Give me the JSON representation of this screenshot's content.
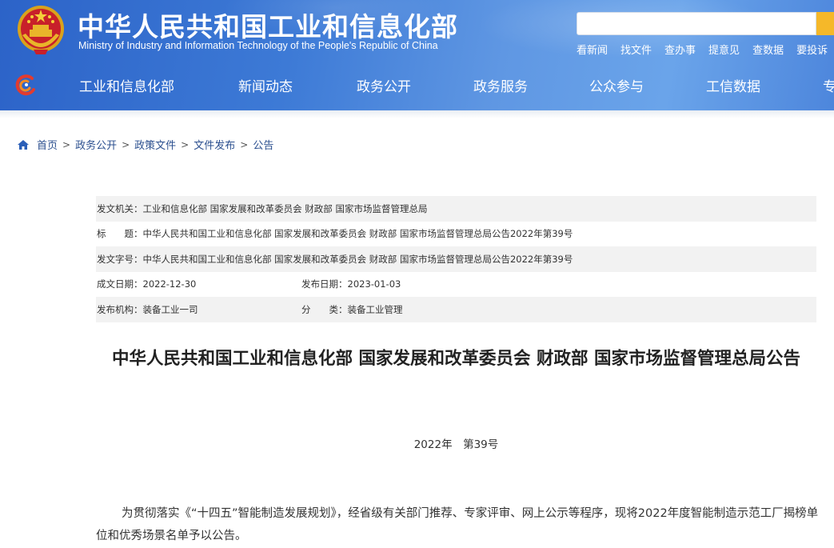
{
  "header": {
    "site_title": "中华人民共和国工业和信息化部",
    "site_subtitle": "Ministry of Industry and Information Technology of the People's Republic of China",
    "search": {
      "placeholder": ""
    },
    "quick_links": [
      "看新闻",
      "找文件",
      "查办事",
      "提意见",
      "查数据",
      "要投诉"
    ],
    "nav": [
      "工业和信息化部",
      "新闻动态",
      "政务公开",
      "政务服务",
      "公众参与",
      "工信数据",
      "专"
    ]
  },
  "breadcrumb": [
    "首页",
    "政务公开",
    "政策文件",
    "文件发布",
    "公告"
  ],
  "meta": {
    "issuing_org_label": "发文机关：",
    "issuing_org": "工业和信息化部 国家发展和改革委员会 财政部 国家市场监督管理总局",
    "title_label": "标　　题：",
    "title": "中华人民共和国工业和信息化部 国家发展和改革委员会 财政部 国家市场监督管理总局公告2022年第39号",
    "doc_no_label": "发文字号：",
    "doc_no": "中华人民共和国工业和信息化部 国家发展和改革委员会 财政部 国家市场监督管理总局公告2022年第39号",
    "written_date_label": "成文日期：",
    "written_date": "2022-12-30",
    "publish_date_label": "发布日期：",
    "publish_date": "2023-01-03",
    "publisher_label": "发布机构：",
    "publisher": "装备工业一司",
    "category_label": "分　　类：",
    "category": "装备工业管理"
  },
  "article": {
    "title": "中华人民共和国工业和信息化部 国家发展和改革委员会 财政部 国家市场监督管理总局公告",
    "doc_number": "2022年　第39号",
    "paragraph": "为贯彻落实《“十四五”智能制造发展规划》，经省级有关部门推荐、专家评审、网上公示等程序，现将2022年度智能制造示范工厂揭榜单位和优秀场景名单予以公告。"
  },
  "colors": {
    "header_blue": "#3d7ad6",
    "search_button": "#f5b829",
    "breadcrumb_link": "#2b4f8f",
    "meta_row_shade": "#f2f2f2"
  },
  "icons": {
    "emblem": "national-emblem",
    "nav_logo": "miit-logo-icon",
    "home": "home-icon",
    "search": "search-icon"
  }
}
